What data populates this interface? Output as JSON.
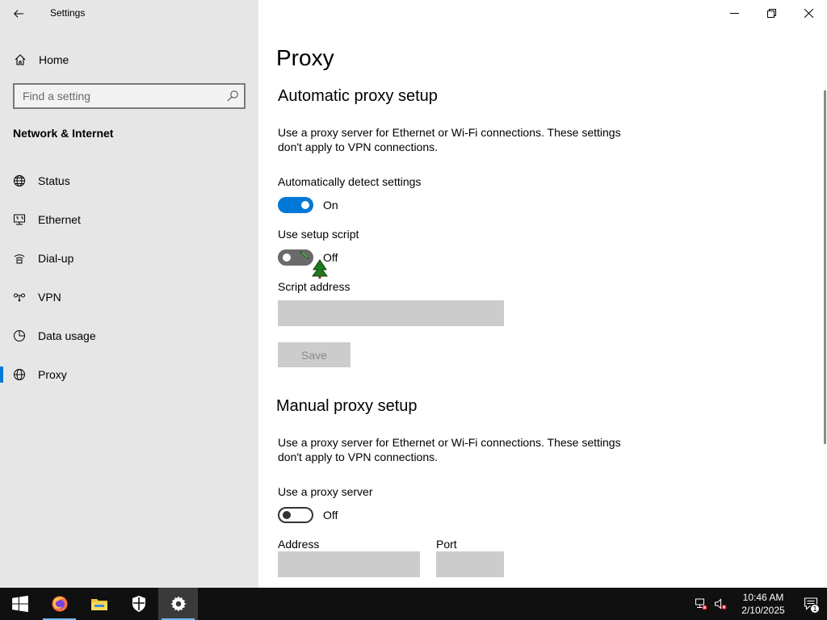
{
  "window": {
    "app_title": "Settings"
  },
  "sidebar": {
    "home_label": "Home",
    "search_placeholder": "Find a setting",
    "section_title": "Network & Internet",
    "items": [
      {
        "label": "Status",
        "icon": "globe-status-icon"
      },
      {
        "label": "Ethernet",
        "icon": "ethernet-icon"
      },
      {
        "label": "Dial-up",
        "icon": "dialup-icon"
      },
      {
        "label": "VPN",
        "icon": "vpn-icon"
      },
      {
        "label": "Data usage",
        "icon": "data-usage-icon"
      },
      {
        "label": "Proxy",
        "icon": "globe-icon",
        "active": true
      }
    ]
  },
  "main": {
    "page_title": "Proxy",
    "automatic": {
      "heading": "Automatic proxy setup",
      "description": "Use a proxy server for Ethernet or Wi-Fi connections. These settings don't apply to VPN connections.",
      "detect_label": "Automatically detect settings",
      "detect_state": "On",
      "script_label": "Use setup script",
      "script_state": "Off",
      "address_label": "Script address",
      "address_value": "",
      "save_label": "Save"
    },
    "manual": {
      "heading": "Manual proxy setup",
      "description": "Use a proxy server for Ethernet or Wi-Fi connections. These settings don't apply to VPN connections.",
      "use_proxy_label": "Use a proxy server",
      "use_proxy_state": "Off",
      "address_label": "Address",
      "address_value": "",
      "port_label": "Port",
      "port_value": ""
    }
  },
  "taskbar": {
    "apps": [
      "start-icon",
      "firefox-icon",
      "file-explorer-icon",
      "windows-security-icon",
      "settings-icon"
    ],
    "time": "10:46 AM",
    "date": "2/10/2025",
    "notification_count": "1"
  },
  "colors": {
    "accent": "#0078d7",
    "sidebar_bg": "#e6e6e6",
    "taskbar_bg": "#101010"
  }
}
